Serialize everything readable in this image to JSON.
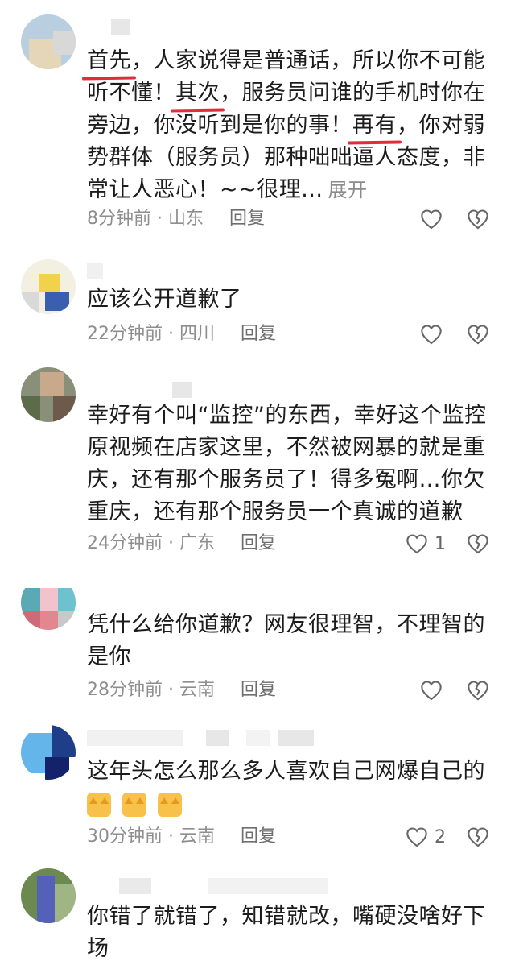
{
  "comments": [
    {
      "text_parts": [
        "首先",
        "，人家说得是普通话，所以你不可能听不懂！",
        "其次",
        "，服务员问谁的手机时你在旁边，你没听到是你的事！",
        "再有",
        "，你对弱势群体（服务员）那种咄咄逼人态度，非常让人恶心！~~很理..."
      ],
      "expand": "展开",
      "time": "8分钟前",
      "location": "山东",
      "reply": "回复",
      "likes": ""
    },
    {
      "text": "应该公开道歉了",
      "time": "22分钟前",
      "location": "四川",
      "reply": "回复",
      "likes": ""
    },
    {
      "text": "幸好有个叫“监控”的东西，幸好这个监控原视频在店家这里，不然被网暴的就是重庆，还有那个服务员了！得多冤啊…你欠重庆，还有那个服务员一个真诚的道歉",
      "time": "24分钟前",
      "location": "广东",
      "reply": "回复",
      "likes": "1"
    },
    {
      "text": "凭什么给你道歉？网友很理智，不理智的是你",
      "time": "28分钟前",
      "location": "云南",
      "reply": "回复",
      "likes": ""
    },
    {
      "text": "这年头怎么那么多人喜欢自己网爆自己的",
      "time": "30分钟前",
      "location": "云南",
      "reply": "回复",
      "likes": "2"
    },
    {
      "text": "你错了就错了，知错就改，嘴硬没啥好下场"
    }
  ],
  "separator": " · ",
  "icons": {
    "like": "heart-outline-icon",
    "dislike": "broken-heart-icon",
    "emoji": "cat-face-emoji"
  },
  "colors": {
    "underline": "#e02d3c",
    "meta": "#8e8e8e"
  }
}
